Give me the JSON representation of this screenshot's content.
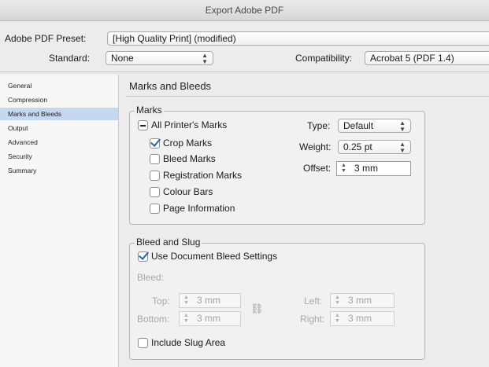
{
  "window": {
    "title": "Export Adobe PDF"
  },
  "header": {
    "preset_label": "Adobe PDF Preset:",
    "preset_value": "[High Quality Print] (modified)",
    "standard_label": "Standard:",
    "standard_value": "None",
    "compat_label": "Compatibility:",
    "compat_value": "Acrobat 5 (PDF 1.4)"
  },
  "sidebar": {
    "items": [
      {
        "label": "General"
      },
      {
        "label": "Compression"
      },
      {
        "label": "Marks and Bleeds",
        "selected": true
      },
      {
        "label": "Output"
      },
      {
        "label": "Advanced"
      },
      {
        "label": "Security"
      },
      {
        "label": "Summary"
      }
    ]
  },
  "main": {
    "title": "Marks and Bleeds",
    "marks": {
      "group_title": "Marks",
      "all_printers_marks": {
        "label": "All Printer's Marks",
        "state": "mixed"
      },
      "crop_marks": {
        "label": "Crop Marks",
        "checked": true
      },
      "bleed_marks": {
        "label": "Bleed Marks",
        "checked": false
      },
      "registration_marks": {
        "label": "Registration Marks",
        "checked": false
      },
      "colour_bars": {
        "label": "Colour Bars",
        "checked": false
      },
      "page_information": {
        "label": "Page Information",
        "checked": false
      },
      "type_label": "Type:",
      "type_value": "Default",
      "weight_label": "Weight:",
      "weight_value": "0.25 pt",
      "offset_label": "Offset:",
      "offset_value": "3 mm"
    },
    "bleed_slug": {
      "group_title": "Bleed and Slug",
      "use_doc_bleed": {
        "label": "Use Document Bleed Settings",
        "checked": true
      },
      "bleed_label": "Bleed:",
      "top_label": "Top:",
      "top_value": "3 mm",
      "bottom_label": "Bottom:",
      "bottom_value": "3 mm",
      "left_label": "Left:",
      "left_value": "3 mm",
      "right_label": "Right:",
      "right_value": "3 mm",
      "include_slug": {
        "label": "Include Slug Area",
        "checked": false
      }
    }
  },
  "colors": {
    "selection": "#c6d8ef",
    "check": "#2a5fb0"
  }
}
